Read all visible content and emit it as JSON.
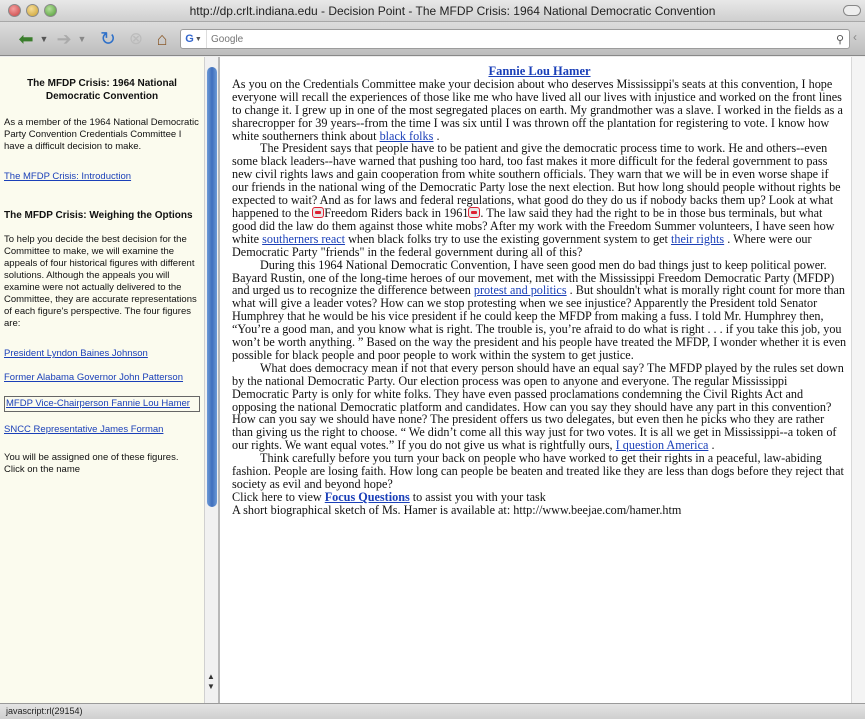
{
  "window": {
    "title": "http://dp.crlt.indiana.edu - Decision Point - The MFDP Crisis: 1964 National Democratic Convention"
  },
  "toolbar": {
    "back_icon": "back-arrow-icon",
    "forward_icon": "forward-arrow-icon",
    "reload_icon": "reload-icon",
    "stop_icon": "stop-icon",
    "home_icon": "home-icon",
    "search_engine": "G",
    "search_placeholder": "Google",
    "search_icon": "magnifier-icon"
  },
  "sidebar": {
    "title": "The MFDP Crisis: 1964 National Democratic Convention",
    "intro": "As a member of the 1964 National Democratic Party Convention Credentials Committee I have a difficult decision to make.",
    "intro_link": "The MFDP Crisis: Introduction",
    "heading": "The MFDP Crisis: Weighing the Options",
    "description": "To help you decide the best decision for the Committee to make, we will examine the appeals of four historical figures with different solutions. Although the appeals you will examine were not actually delivered to the Committee, they are accurate representations of each figure's perspective. The four figures are:",
    "figures": [
      "President Lyndon Baines Johnson",
      "Former Alabama Governor John Patterson",
      "MFDP Vice-Chairperson Fannie Lou Hamer",
      "SNCC Representative James Forman"
    ],
    "assign_text": "You will be assigned one of these figures. Click on the name"
  },
  "main": {
    "title": "Fannie Lou Hamer",
    "p1_a": "As you on the Credentials Committee make your decision about who deserves Mississippi's seats at this convention, I hope everyone will recall the experiences of those like me who have lived all our lives with injustice and worked on the front lines to change it. I grew up in one of the most segregated places on earth. My grandmother was a slave. I worked in the fields as a sharecropper for 39 years--from the time I was six until I was thrown off the plantation for registering to vote. I know how white southerners think about ",
    "p1_link": "black folks",
    "p1_b": " .",
    "p2_a": "The President says that people have to be patient and give the democratic process time to work. He and others--even some black leaders--have warned that pushing too hard, too fast makes it more difficult for the federal government to pass new civil rights laws and gain cooperation from white southern officials. They warn that we will be in even worse shape if our friends in the national wing of the Democratic Party lose the next election. But how long should people without rights be expected to wait? And as for laws and federal regulations, what good do they do us if nobody backs them up? Look at what happened to the ",
    "p2_mid": "Freedom Riders back in 1961",
    "p2_b": ". The law said they had the right to be in those bus terminals, but what good did the law do them against those white mobs? After my work with the Freedom Summer volunteers, I have seen how white ",
    "p2_link1": "southerners react",
    "p2_c": " when black folks try to use the existing government system to get ",
    "p2_link2": "their rights",
    "p2_d": " . Where were our Democratic Party \"friends\" in the federal government during all of this?",
    "p3_a": "During this 1964 National Democratic Convention, I have seen good men do bad things just to keep political power. Bayard Rustin, one of the long-time heroes of our movement, met with the Mississippi Freedom Democratic Party (MFDP) and urged us to recognize the difference between ",
    "p3_link": "protest and politics",
    "p3_b": " . But shouldn't what is morally right count for more than what will give a leader votes? How can we stop protesting when we see injustice? Apparently the President told Senator Humphrey that he would be his vice president if he could keep the MFDP from making a fuss. I told Mr. Humphrey then, “You’re a good man, and you know what is right. The trouble is, you’re afraid to do what is right . . . if you take this job, you won’t be worth anything. ” Based on the way the president and his people have treated the MFDP, I wonder whether it is even possible for black people and poor people to work within the system to get justice.",
    "p4_a": "What does democracy mean if not that every person should have an equal say? The MFDP played by the rules set down by the national Democratic Party. Our election process was open to anyone and everyone. The regular Mississippi Democratic Party is only for white folks. They have even passed proclamations condemning the Civil Rights Act and opposing the national Democratic platform and candidates. How can you say they should have any part in this convention? How can you say we should have none? The president offers us two delegates, but even then he picks who they are rather than giving us the right to choose. “ We didn’t come all this way just for two votes. It is all we get in Mississippi--a token of our rights. We want equal votes.” If you do not give us what is rightfully ours, ",
    "p4_link": "I question America",
    "p4_b": " .",
    "p5_a": "Think carefully before you turn your back on people who have worked to get their rights in a peaceful, law-abiding fashion. People are losing faith. How long can people be beaten and treated like they are less than dogs before they reject that society as evil and beyond hope?",
    "p6_a": "Click here to view ",
    "p6_link": "Focus Questions",
    "p6_b": " to assist you with your task",
    "p7_a": "A short biographical sketch of Ms. Hamer is available at: http://www.beejae.com/hamer.htm"
  },
  "status": {
    "text": "javascript:rl(29154)"
  }
}
